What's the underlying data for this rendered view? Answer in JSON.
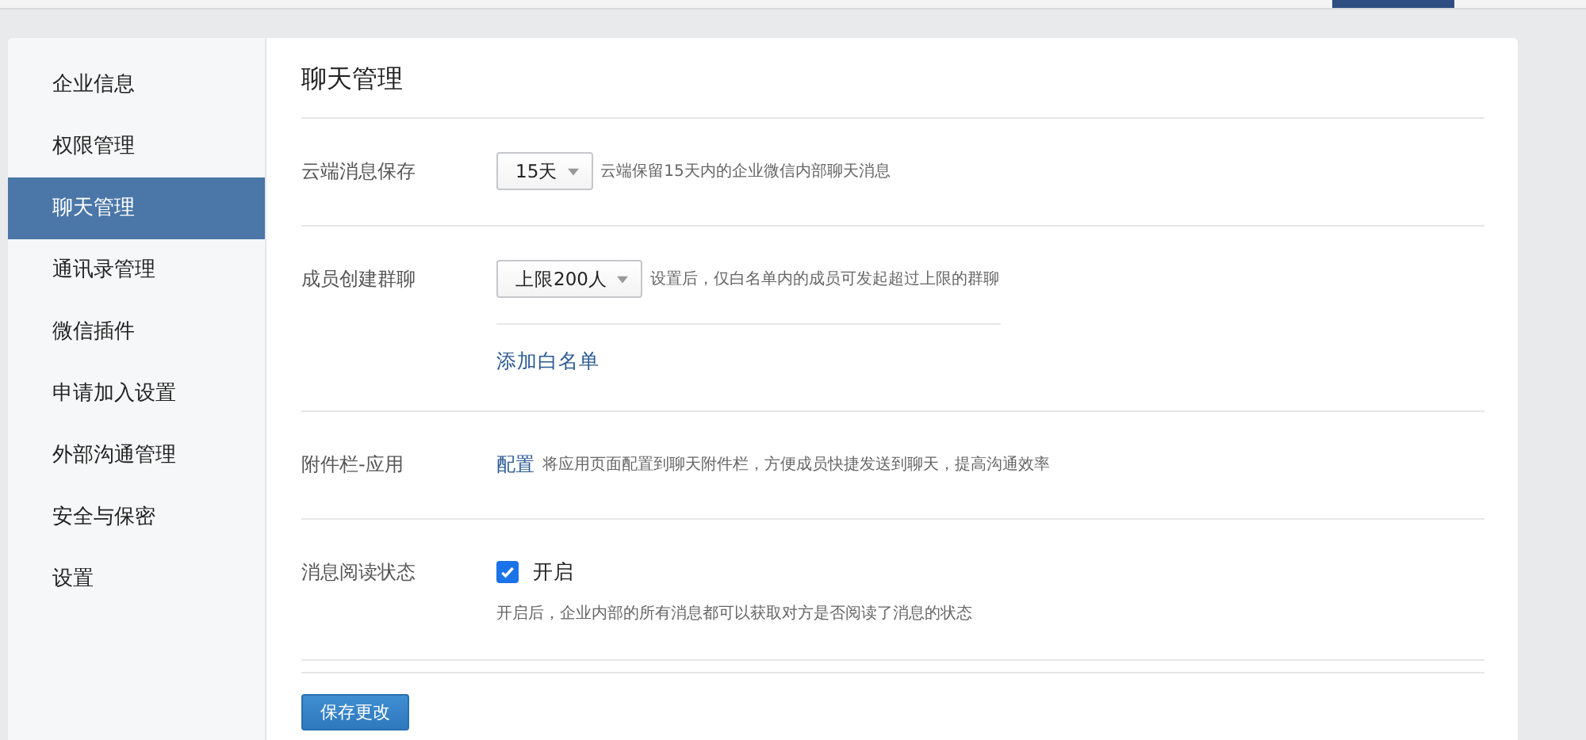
{
  "sidebar": {
    "items": [
      {
        "label": "企业信息",
        "selected": false
      },
      {
        "label": "权限管理",
        "selected": false
      },
      {
        "label": "聊天管理",
        "selected": true
      },
      {
        "label": "通讯录管理",
        "selected": false
      },
      {
        "label": "微信插件",
        "selected": false
      },
      {
        "label": "申请加入设置",
        "selected": false
      },
      {
        "label": "外部沟通管理",
        "selected": false
      },
      {
        "label": "安全与保密",
        "selected": false
      },
      {
        "label": "设置",
        "selected": false
      }
    ]
  },
  "title": "聊天管理",
  "settings": [
    {
      "kind": "select",
      "label": "云端消息保存",
      "value": "15天",
      "hint": "云端保留15天内的企业微信内部聊天消息"
    },
    {
      "kind": "select",
      "label": "成员创建群聊",
      "value": "上限200人",
      "hint": "设置后，仅白名单内的成员可发起超过上限的群聊",
      "link": "添加白名单"
    },
    {
      "kind": "link",
      "label": "附件栏-应用",
      "link": "配置",
      "hint": "将应用页面配置到聊天附件栏，方便成员快捷发送到聊天，提高沟通效率"
    },
    {
      "kind": "checkbox",
      "label": "消息阅读状态",
      "option": "开启",
      "checked": true,
      "hint": "开启后，企业内部的所有消息都可以获取对方是否阅读了消息的状态"
    }
  ],
  "save_button": "保存更改"
}
